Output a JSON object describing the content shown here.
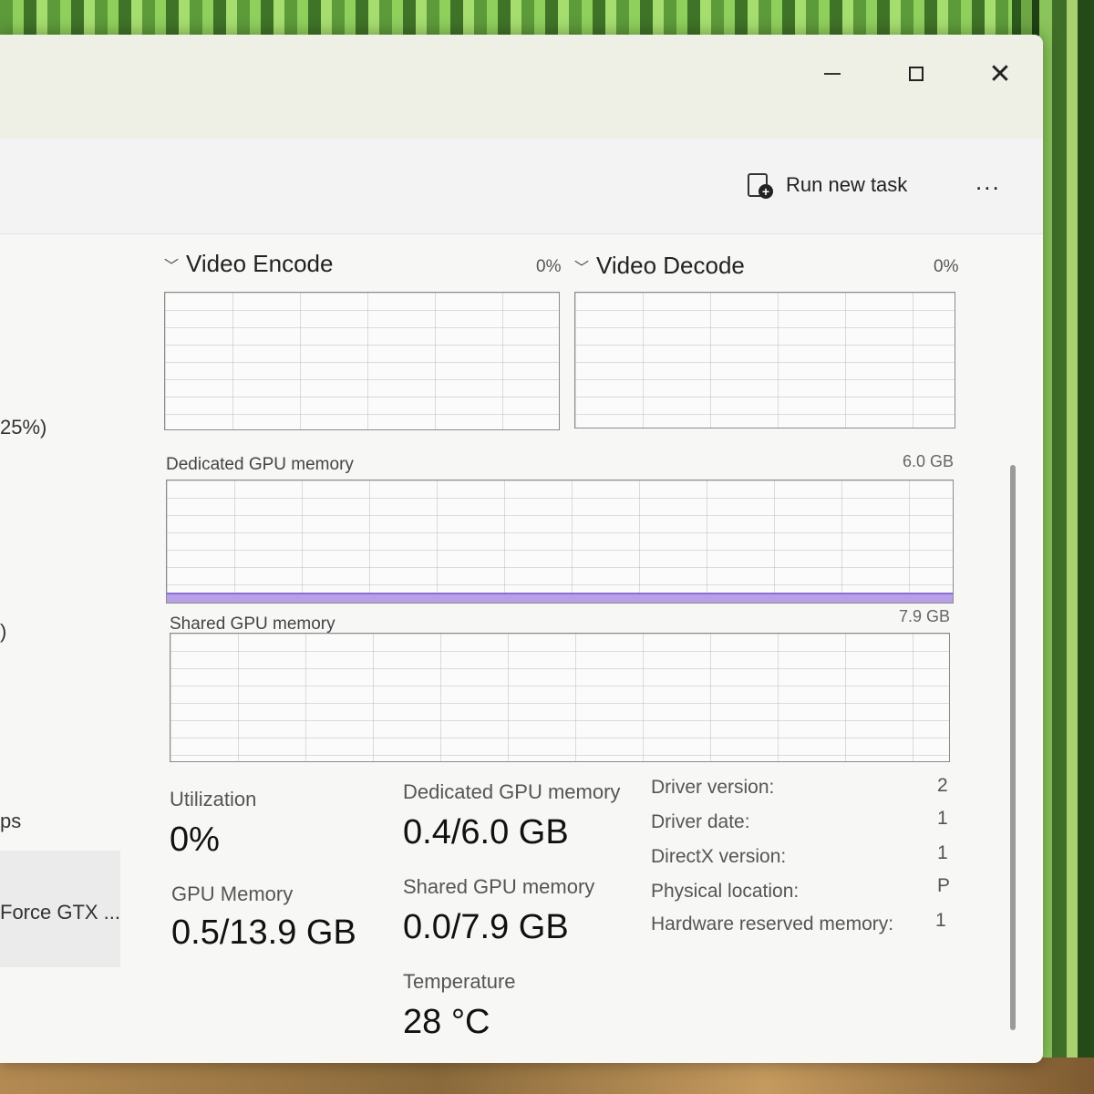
{
  "command_bar": {
    "run_new_task": "Run new task",
    "more_label": "..."
  },
  "sidebar_fragments": [
    "25%)",
    ")",
    "ps",
    "Force GTX ..."
  ],
  "video_encode": {
    "title": "Video Encode",
    "value": "0%"
  },
  "video_decode": {
    "title": "Video Decode",
    "value": "0%"
  },
  "dedicated_graph": {
    "title": "Dedicated GPU memory",
    "max": "6.0 GB",
    "fill_fraction": 0.067,
    "fill_color": "#b8a0e6"
  },
  "shared_graph": {
    "title": "Shared GPU memory",
    "max": "7.9 GB"
  },
  "stats": {
    "utilization": {
      "label": "Utilization",
      "value": "0%"
    },
    "gpu_memory": {
      "label": "GPU Memory",
      "value": "0.5/13.9 GB"
    },
    "dedicated": {
      "label": "Dedicated GPU memory",
      "value": "0.4/6.0 GB"
    },
    "shared": {
      "label": "Shared GPU memory",
      "value": "0.0/7.9 GB"
    },
    "temperature": {
      "label": "Temperature",
      "value": "28 °C"
    }
  },
  "info": [
    {
      "label": "Driver version:",
      "value": "2"
    },
    {
      "label": "Driver date:",
      "value": "1"
    },
    {
      "label": "DirectX version:",
      "value": "1"
    },
    {
      "label": "Physical location:",
      "value": "P"
    },
    {
      "label": "Hardware reserved memory:",
      "value": "1"
    }
  ]
}
